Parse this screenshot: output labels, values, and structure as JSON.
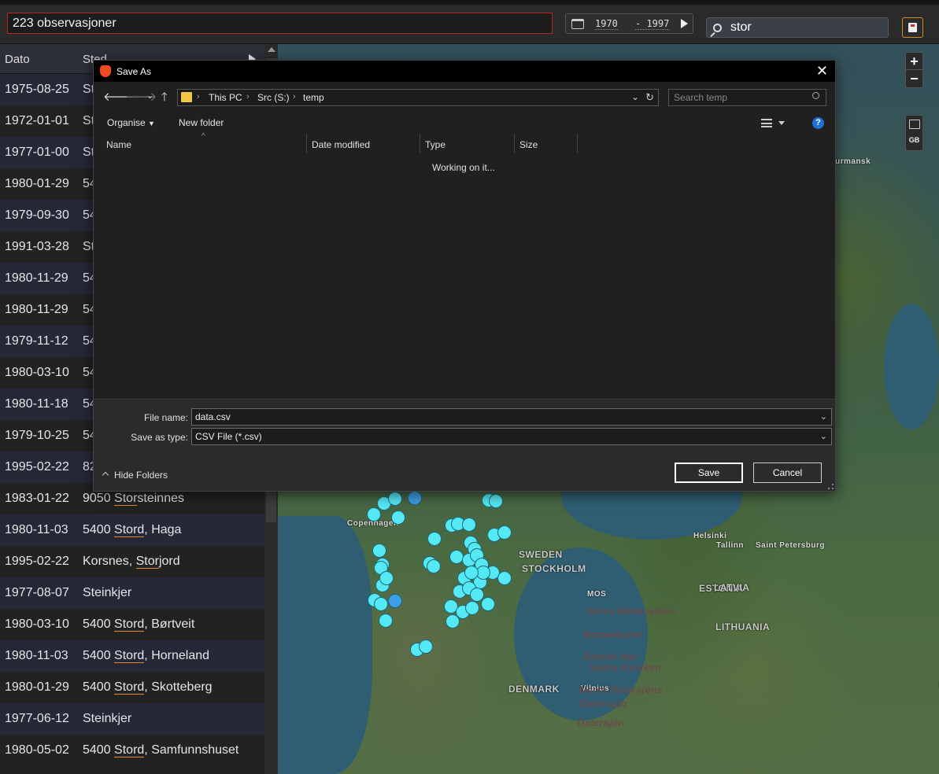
{
  "header": {
    "observations": "223 observasjoner",
    "date_from": "1970",
    "date_to": "- 1997",
    "search_value": "stor"
  },
  "list": {
    "columns": [
      "Dato",
      "Sted"
    ],
    "rows": [
      {
        "date": "1975-08-25",
        "place": "St"
      },
      {
        "date": "1972-01-01",
        "place": "St"
      },
      {
        "date": "1977-01-00",
        "place": "St"
      },
      {
        "date": "1980-01-29",
        "place": "54"
      },
      {
        "date": "1979-09-30",
        "place": "54"
      },
      {
        "date": "1991-03-28",
        "place": "St"
      },
      {
        "date": "1980-11-29",
        "place": "54"
      },
      {
        "date": "1980-11-29",
        "place": "54"
      },
      {
        "date": "1979-11-12",
        "place": "54"
      },
      {
        "date": "1980-03-10",
        "place": "54"
      },
      {
        "date": "1980-11-18",
        "place": "54"
      },
      {
        "date": "1979-10-25",
        "place": "54"
      },
      {
        "date": "1995-02-22",
        "place": "82"
      },
      {
        "date": "1983-01-22",
        "pre": "9050 ",
        "hl": "Stor",
        "post": "steinnes"
      },
      {
        "date": "1980-11-03",
        "pre": "5400 ",
        "hl": "Stord",
        "post": ", Haga"
      },
      {
        "date": "1995-02-22",
        "pre": "Korsnes, ",
        "hl": "Stor",
        "post": "jord"
      },
      {
        "date": "1977-08-07",
        "place": "Steinkjer"
      },
      {
        "date": "1980-03-10",
        "pre": "5400 ",
        "hl": "Stord",
        "post": ", Børtveit"
      },
      {
        "date": "1980-11-03",
        "pre": "5400 ",
        "hl": "Stord",
        "post": ", Horneland"
      },
      {
        "date": "1980-01-29",
        "pre": "5400 ",
        "hl": "Stord",
        "post": ", Skotteberg"
      },
      {
        "date": "1977-06-12",
        "place": "Steinkjer"
      },
      {
        "date": "1980-05-02",
        "pre": "5400 ",
        "hl": "Stord",
        "post": ", Samfunnshuset"
      }
    ]
  },
  "map": {
    "labels": [
      {
        "t": "urmansk",
        "cls": ""
      },
      {
        "t": "SWEDEN",
        "cls": "big"
      },
      {
        "t": "STOCKHOLM",
        "cls": "big"
      },
      {
        "t": "Helsinki",
        "cls": ""
      },
      {
        "t": "Saint Petersburg",
        "cls": ""
      },
      {
        "t": "Tallinn",
        "cls": ""
      },
      {
        "t": "ESTONIA",
        "cls": "big"
      },
      {
        "t": "LATVIA",
        "cls": "big"
      },
      {
        "t": "LITHUANIA",
        "cls": "big"
      },
      {
        "t": "Vilnius",
        "cls": ""
      },
      {
        "t": "DENMARK",
        "cls": "big"
      },
      {
        "t": "Copenhagen",
        "cls": ""
      },
      {
        "t": "Berge",
        "cls": ""
      },
      {
        "t": "MOS",
        "cls": ""
      },
      {
        "t": "Norra Bottenviken",
        "cls": "faint"
      },
      {
        "t": "Bottenhavet",
        "cls": "faint"
      },
      {
        "t": "Ålands hav",
        "cls": "faint"
      },
      {
        "t": "Södra Kvarken",
        "cls": "faint"
      },
      {
        "t": "Norra Östersjöns",
        "cls": "faint"
      },
      {
        "t": "Östersjön",
        "cls": "faint"
      },
      {
        "t": "Östersjön",
        "cls": "faint"
      }
    ],
    "zoom_in": "+",
    "zoom_out": "−",
    "layer_label": "GB"
  },
  "dialog": {
    "title": "Save As",
    "close": "✕",
    "breadcrumbs": [
      "This PC",
      "Src (S:)",
      "temp"
    ],
    "search_placeholder": "Search temp",
    "organise": "Organise",
    "new_folder": "New folder",
    "columns": [
      "Name",
      "Date modified",
      "Type",
      "Size"
    ],
    "status": "Working on it...",
    "file_name_label": "File name:",
    "file_name_value": "data.csv",
    "save_type_label": "Save as type:",
    "save_type_value": "CSV File (*.csv)",
    "hide_folders": "Hide Folders",
    "save": "Save",
    "cancel": "Cancel",
    "help": "?"
  }
}
